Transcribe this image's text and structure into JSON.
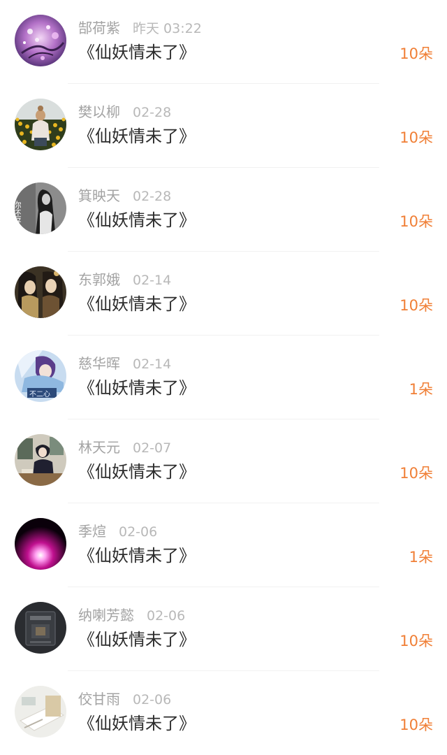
{
  "gifts": [
    {
      "name": "郜荷紫",
      "time": "昨天 03:22",
      "title": "《仙妖情未了》",
      "amount": "10朵",
      "avatar_icon": "avatar-purple-blossom"
    },
    {
      "name": "樊以柳",
      "time": "02-28",
      "title": "《仙妖情未了》",
      "amount": "10朵",
      "avatar_icon": "avatar-girl-sunflowers"
    },
    {
      "name": "箕映天",
      "time": "02-28",
      "title": "《仙妖情未了》",
      "amount": "10朵",
      "avatar_icon": "avatar-grayscale-girl",
      "avatar_text": "你还好吗"
    },
    {
      "name": "东郭娥",
      "time": "02-14",
      "title": "《仙妖情未了》",
      "amount": "10朵",
      "avatar_icon": "avatar-anime-couple"
    },
    {
      "name": "慈华晖",
      "time": "02-14",
      "title": "《仙妖情未了》",
      "amount": "1朵",
      "avatar_icon": "avatar-anime-boy-blue",
      "avatar_text": "不二心"
    },
    {
      "name": "林天元",
      "time": "02-07",
      "title": "《仙妖情未了》",
      "amount": "10朵",
      "avatar_icon": "avatar-boy-desk"
    },
    {
      "name": "季煊",
      "time": "02-06",
      "title": "《仙妖情未了》",
      "amount": "1朵",
      "avatar_icon": "avatar-magenta-glow"
    },
    {
      "name": "纳喇芳懿",
      "time": "02-06",
      "title": "《仙妖情未了》",
      "amount": "10朵",
      "avatar_icon": "avatar-dark-screen"
    },
    {
      "name": "佼甘雨",
      "time": "02-06",
      "title": "《仙妖情未了》",
      "amount": "10朵",
      "avatar_icon": "avatar-desk-items"
    }
  ],
  "colors": {
    "amount": "#f07f36",
    "name": "#a3a3a3",
    "time": "#b8b8b8",
    "title": "#2c2c2c"
  }
}
